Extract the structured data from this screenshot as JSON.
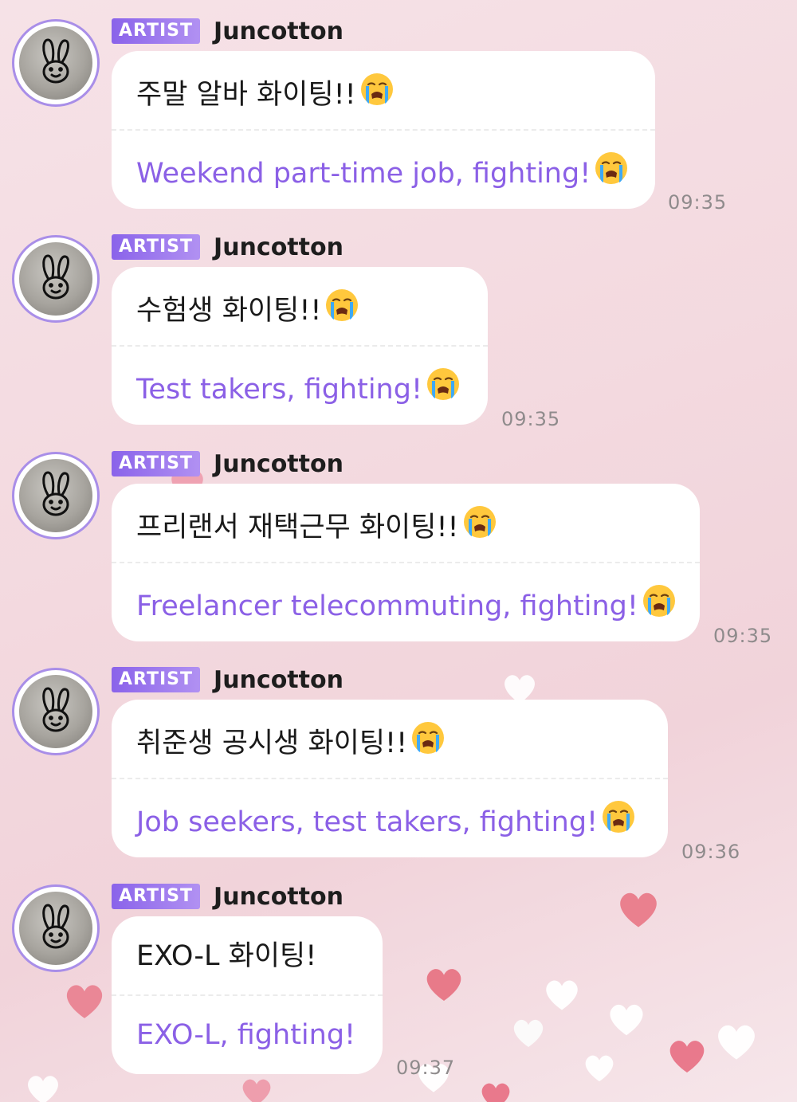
{
  "messages": [
    {
      "badge": "ARTIST",
      "author": "Juncotton",
      "korean": "주말 알바 화이팅!!",
      "english": "Weekend part-time job, fighting!",
      "time": "09:35",
      "emoji": "loudly-crying-face"
    },
    {
      "badge": "ARTIST",
      "author": "Juncotton",
      "korean": "수험생 화이팅!!",
      "english": "Test takers, fighting!",
      "time": "09:35",
      "emoji": "loudly-crying-face"
    },
    {
      "badge": "ARTIST",
      "author": "Juncotton",
      "korean": "프리랜서 재택근무 화이팅!!",
      "english": "Freelancer telecommuting, fighting!",
      "time": "09:35",
      "emoji": "loudly-crying-face"
    },
    {
      "badge": "ARTIST",
      "author": "Juncotton",
      "korean": "취준생 공시생 화이팅!!",
      "english": "Job seekers, test takers, fighting!",
      "time": "09:36",
      "emoji": "loudly-crying-face"
    },
    {
      "badge": "ARTIST",
      "author": "Juncotton",
      "korean": "EXO-L 화이팅!",
      "english": "EXO-L, fighting!",
      "time": "09:37",
      "emoji": ""
    }
  ],
  "colors": {
    "badge": "#8a63ea",
    "translation_text": "#8b60e6",
    "avatar_ring": "#a98ee8",
    "background": "#f3d9df"
  },
  "icons": {
    "avatar": "bunny-doodle-avatar",
    "emoji": "loudly-crying-face-emoji",
    "background": "heart-confetti"
  }
}
